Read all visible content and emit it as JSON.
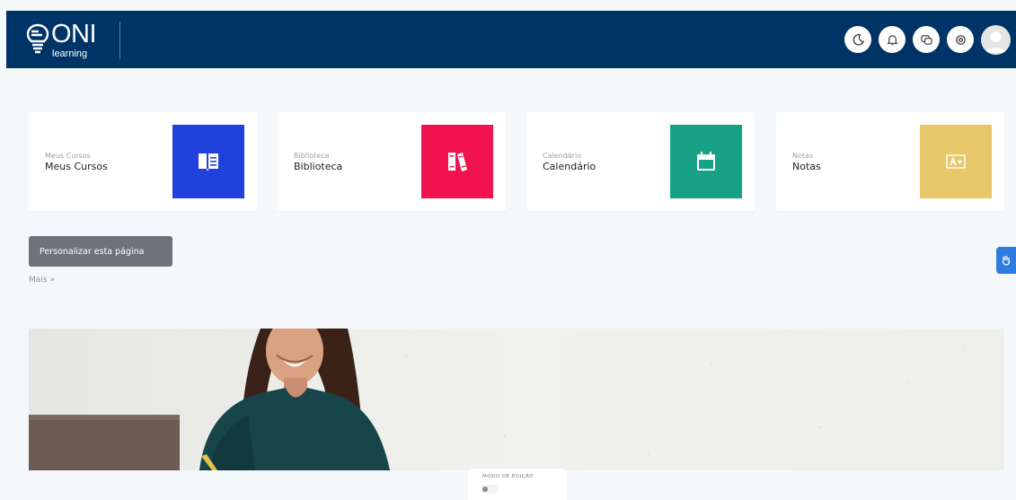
{
  "header": {
    "logo_text": "ONI",
    "logo_subtext": "learning",
    "icons": [
      "moon-icon",
      "bell-icon",
      "chat-icon",
      "settings-icon"
    ]
  },
  "cards": [
    {
      "small": "Meus Cursos",
      "title": "Meus Cursos",
      "color": "#2141dd",
      "icon": "book-icon"
    },
    {
      "small": "Biblioteca",
      "title": "Biblioteca",
      "color": "#f0134f",
      "icon": "library-icon"
    },
    {
      "small": "Calendário",
      "title": "Calendário",
      "color": "#17a286",
      "icon": "calendar-icon"
    },
    {
      "small": "Notas",
      "title": "Notas",
      "color": "#e6c769",
      "icon": "grade-icon"
    }
  ],
  "customize_label": "Personalizar esta página",
  "more_label": "Mais",
  "edit_mode_label": "MODO DE EDIÇÃO",
  "colors": {
    "header_bg": "#003466",
    "page_bg": "#f5f8fb",
    "button_bg": "#6c737a",
    "side_tab": "#2f7ce0"
  }
}
